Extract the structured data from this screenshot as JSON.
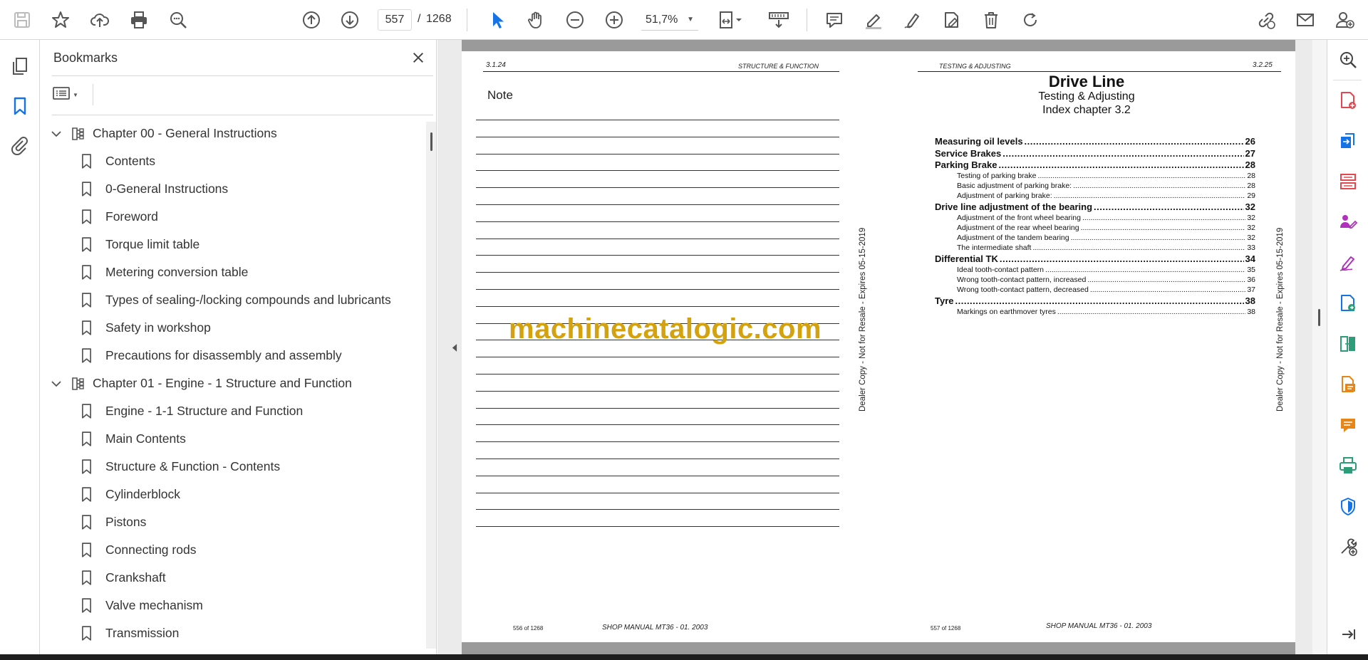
{
  "toolbar": {
    "page_current": "557",
    "page_separator": "/",
    "page_total": "1268",
    "zoom": "51,7%"
  },
  "bookmarks": {
    "title": "Bookmarks",
    "items": [
      {
        "label": "Chapter 00 - General Instructions",
        "level": 0
      },
      {
        "label": "Contents",
        "level": 1
      },
      {
        "label": "0-General Instructions",
        "level": 1
      },
      {
        "label": "Foreword",
        "level": 1
      },
      {
        "label": "Torque limit table",
        "level": 1
      },
      {
        "label": "Metering conversion table",
        "level": 1
      },
      {
        "label": "Types of sealing-/locking compounds and lubricants",
        "level": 1
      },
      {
        "label": "Safety in workshop",
        "level": 1
      },
      {
        "label": "Precautions for disassembly and assembly",
        "level": 1
      },
      {
        "label": "Chapter 01 - Engine - 1 Structure and Function",
        "level": 0
      },
      {
        "label": "Engine - 1-1 Structure and Function",
        "level": 1
      },
      {
        "label": "Main Contents",
        "level": 1
      },
      {
        "label": "Structure & Function - Contents",
        "level": 1
      },
      {
        "label": "Cylinderblock",
        "level": 1
      },
      {
        "label": "Pistons",
        "level": 1
      },
      {
        "label": "Connecting rods",
        "level": 1
      },
      {
        "label": "Crankshaft",
        "level": 1
      },
      {
        "label": "Valve mechanism",
        "level": 1
      },
      {
        "label": "Transmission",
        "level": 1
      }
    ]
  },
  "left_page": {
    "section_number": "3.1.24",
    "section_title": "STRUCTURE & FUNCTION",
    "note_label": "Note",
    "side_text": "Dealer Copy - Not for Resale - Expires 05-15-2019",
    "footer_pages": "556 of 1268",
    "footer_manual": "SHOP MANUAL MT36  -  01. 2003"
  },
  "right_page": {
    "section_title": "TESTING & ADJUSTING",
    "section_number": "3.2.25",
    "title": "Drive Line",
    "subtitle": "Testing & Adjusting",
    "index_line": "Index chapter 3.2",
    "side_text": "Dealer Copy - Not for Resale - Expires 05-15-2019",
    "footer_pages": "557 of 1268",
    "footer_manual": "SHOP MANUAL MT36  -  01. 2003",
    "toc": [
      {
        "label": "Measuring oil levels",
        "page": "26",
        "major": true
      },
      {
        "label": "Service Brakes",
        "page": "27",
        "major": true
      },
      {
        "label": "Parking Brake",
        "page": "28",
        "major": true
      },
      {
        "label": "Testing of parking brake",
        "page": "28",
        "major": false
      },
      {
        "label": "Basic adjustment of parking brake:",
        "page": "28",
        "major": false
      },
      {
        "label": "Adjustment of parking brake:",
        "page": "29",
        "major": false
      },
      {
        "label": "Drive line adjustment of the bearing",
        "page": "32",
        "major": true
      },
      {
        "label": "Adjustment of the front wheel bearing",
        "page": "32",
        "major": false
      },
      {
        "label": "Adjustment of the rear wheel bearing",
        "page": "32",
        "major": false
      },
      {
        "label": "Adjustment of the tandem bearing",
        "page": "32",
        "major": false
      },
      {
        "label": "The intermediate shaft",
        "page": "33",
        "major": false
      },
      {
        "label": "Differential TK",
        "page": "34",
        "major": true
      },
      {
        "label": "Ideal tooth-contact pattern",
        "page": "35",
        "major": false
      },
      {
        "label": "Wrong tooth-contact pattern, increased",
        "page": "36",
        "major": false
      },
      {
        "label": "Wrong tooth-contact pattern, decreased",
        "page": "37",
        "major": false
      },
      {
        "label": "Tyre",
        "page": "38",
        "major": true
      },
      {
        "label": "Markings on earthmover tyres",
        "page": "38",
        "major": false
      }
    ]
  },
  "watermark": "machinecatalogic.com",
  "colors": {
    "accent": "#1473e6",
    "watermark": "#d4a20e"
  }
}
